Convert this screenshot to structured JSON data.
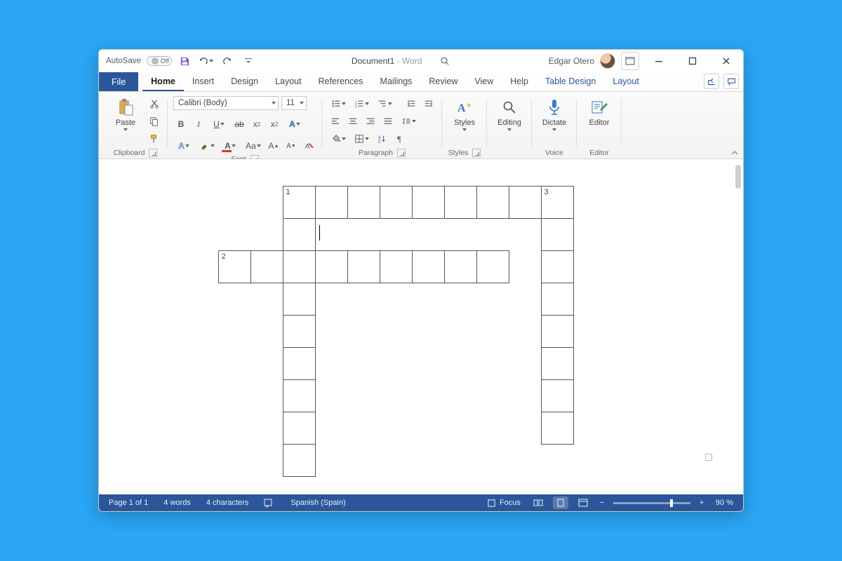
{
  "title": {
    "document": "Document1",
    "separator": " - ",
    "app": "Word"
  },
  "autosave": {
    "label": "AutoSave",
    "state_text": "Off"
  },
  "qat": {
    "save": "save-icon",
    "undo": "undo-icon",
    "redo": "redo-icon",
    "customize": "customize-qat"
  },
  "search": {
    "placeholder": "Search"
  },
  "user": {
    "name": "Edgar Otero"
  },
  "window_controls": {
    "minimize": "minimize-icon",
    "maximize": "maximize-icon",
    "close": "close-icon",
    "ribbon_display": "ribbon-display-options"
  },
  "tabs": {
    "file": "File",
    "items": [
      "Home",
      "Insert",
      "Design",
      "Layout",
      "References",
      "Mailings",
      "Review",
      "View",
      "Help"
    ],
    "contextual": [
      "Table Design",
      "Layout"
    ],
    "active": "Home",
    "share": "share-icon",
    "comments": "comments-icon"
  },
  "ribbon": {
    "clipboard": {
      "label": "Clipboard",
      "paste": "Paste",
      "cut": "cut-icon",
      "copy": "copy-icon",
      "format_painter": "format-painter-icon"
    },
    "font": {
      "label": "Font",
      "name": "Calibri (Body)",
      "size": "11",
      "bold": "B",
      "italic": "I",
      "underline": "U",
      "strike": "ab",
      "subscript": "x₂",
      "superscript": "x²",
      "text_effects": "A",
      "highlight": "highlight-icon",
      "font_color": "A",
      "change_case": "Aa",
      "clear_formatting": "clear-formatting-icon",
      "grow": "A▲",
      "shrink": "A▼"
    },
    "paragraph": {
      "label": "Paragraph",
      "bullets": "bullets-icon",
      "numbering": "numbering-icon",
      "multilevel": "multilevel-icon",
      "dec_indent": "decrease-indent-icon",
      "inc_indent": "increase-indent-icon",
      "align_left": "align-left-icon",
      "align_center": "align-center-icon",
      "align_right": "align-right-icon",
      "justify": "justify-icon",
      "line_spacing": "line-spacing-icon",
      "shading": "shading-icon",
      "borders": "borders-icon",
      "sort": "sort-icon",
      "show_marks": "¶"
    },
    "styles": {
      "label": "Styles",
      "button": "Styles"
    },
    "editing": {
      "label": "Editing",
      "button": "Editing"
    },
    "voice": {
      "label": "Voice",
      "button": "Dictate"
    },
    "editor": {
      "label": "Editor",
      "button": "Editor"
    }
  },
  "crossword": {
    "cell_size_px": 46,
    "cols": 11,
    "rows": 9,
    "active_cells": [
      [
        0,
        2
      ],
      [
        0,
        3
      ],
      [
        0,
        4
      ],
      [
        0,
        5
      ],
      [
        0,
        6
      ],
      [
        0,
        7
      ],
      [
        0,
        8
      ],
      [
        0,
        9
      ],
      [
        0,
        10
      ],
      [
        1,
        2
      ],
      [
        1,
        10
      ],
      [
        2,
        0
      ],
      [
        2,
        1
      ],
      [
        2,
        2
      ],
      [
        2,
        3
      ],
      [
        2,
        4
      ],
      [
        2,
        5
      ],
      [
        2,
        6
      ],
      [
        2,
        7
      ],
      [
        2,
        8
      ],
      [
        2,
        10
      ],
      [
        3,
        2
      ],
      [
        3,
        10
      ],
      [
        4,
        2
      ],
      [
        4,
        10
      ],
      [
        5,
        2
      ],
      [
        5,
        10
      ],
      [
        6,
        2
      ],
      [
        6,
        10
      ],
      [
        7,
        2
      ],
      [
        7,
        10
      ],
      [
        8,
        2
      ]
    ],
    "numbers": {
      "0,2": "1",
      "0,10": "3",
      "2,0": "2"
    },
    "cursor_cell": [
      1,
      3
    ]
  },
  "statusbar": {
    "page": "Page 1 of 1",
    "words": "4 words",
    "chars": "4 characters",
    "language": "Spanish (Spain)",
    "focus": "Focus",
    "zoom_pct": "90 %",
    "zoom_value": 0.9
  }
}
